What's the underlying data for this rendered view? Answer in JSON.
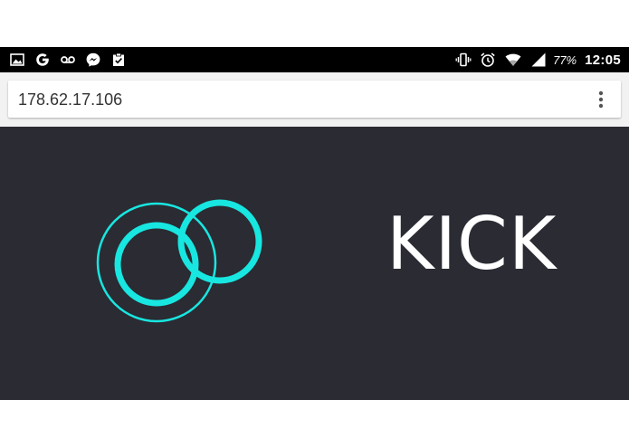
{
  "status_bar": {
    "left_icons": [
      "image-notification-icon",
      "google-icon",
      "voicemail-icon",
      "messenger-icon",
      "clipboard-check-icon"
    ],
    "right_icons": [
      "vibrate-icon",
      "alarm-icon",
      "wifi-icon",
      "signal-icon"
    ],
    "battery": "77%",
    "time": "12:05"
  },
  "browser": {
    "url": "178.62.17.106",
    "menu_icon": "more-vert-icon"
  },
  "page": {
    "background": "#2a2b33",
    "accent": "#18e6e0",
    "title": "KICK"
  }
}
